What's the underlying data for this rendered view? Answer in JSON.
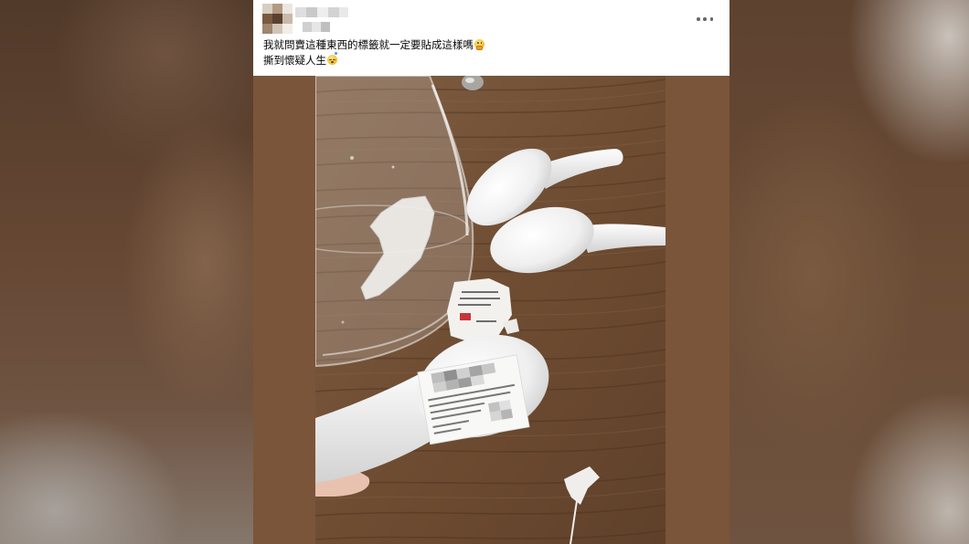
{
  "colors": {
    "card_background": "#ffffff",
    "photo_frame": "#7b5539",
    "post_text": "#050505",
    "icon_gray": "#65676b",
    "wood_table": "#6e4c33",
    "porcelain": "#f2f2f2"
  },
  "post": {
    "avatar_icon": "avatar-icon",
    "menu_icon": "more-options-icon",
    "lines": [
      {
        "text": "我就問賣這種東西的標籤就一定要貼成這樣嗎",
        "emoji_icon": "thinking-face-emoji"
      },
      {
        "text": "撕到懷疑人生",
        "emoji_icon": "sleeping-face-emoji"
      }
    ]
  }
}
